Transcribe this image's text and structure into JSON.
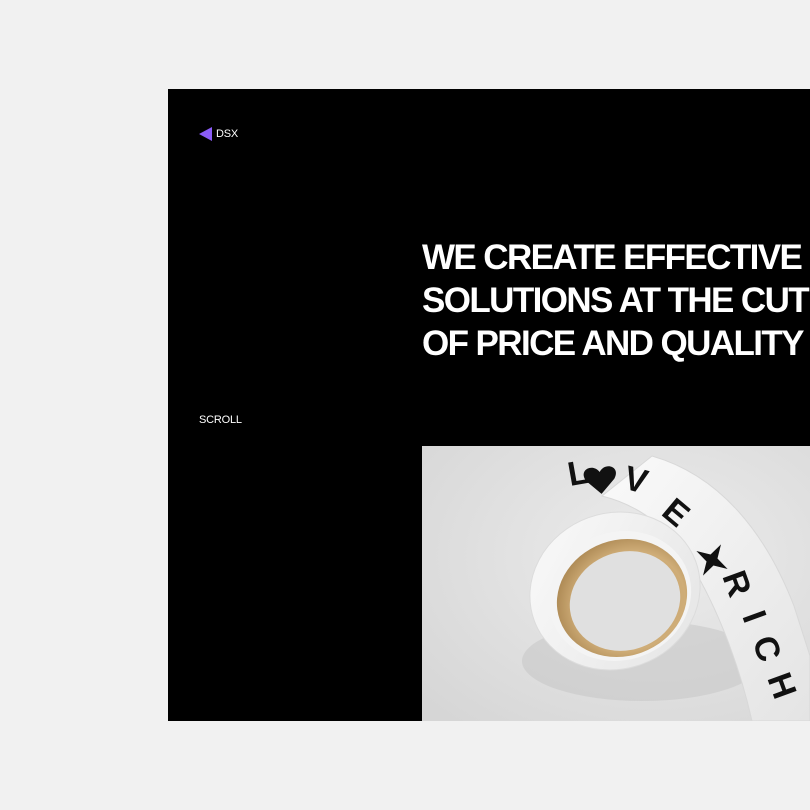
{
  "brand": {
    "name": "DSX",
    "accent_color": "#8a5cf6"
  },
  "hero": {
    "headline_lines": [
      "WE CREATE EFFECTIVE",
      "SOLUTIONS AT THE CUT",
      "OF PRICE AND QUALITY"
    ]
  },
  "scroll_label": "SCROLL",
  "media": {
    "tape_text_top": "L♥VE",
    "tape_text_side": "RICH"
  },
  "colors": {
    "page_bg": "#f1f1f1",
    "frame_bg": "#000000",
    "text": "#ffffff"
  }
}
